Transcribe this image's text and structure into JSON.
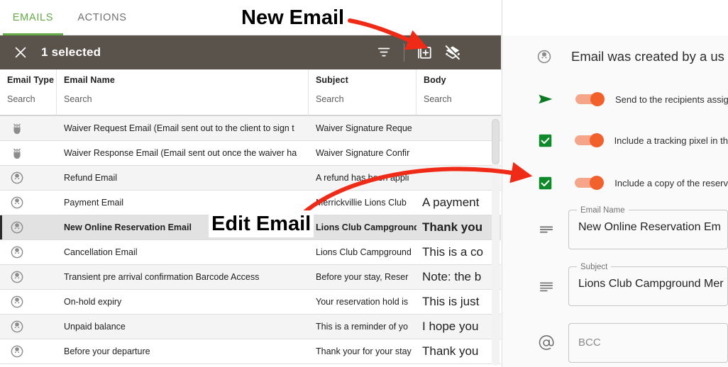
{
  "tabs": [
    {
      "label": "EMAILS",
      "active": true
    },
    {
      "label": "ACTIONS",
      "active": false
    }
  ],
  "selection_bar": {
    "close_icon": "close-icon",
    "count_label": "1 selected",
    "actions": [
      {
        "icon": "filter-icon",
        "name": "filter-button"
      },
      {
        "icon": "add-new-icon",
        "name": "new-email-button"
      },
      {
        "icon": "layers-off-icon",
        "name": "layers-off-button"
      }
    ]
  },
  "table": {
    "columns": [
      {
        "title": "Email Type",
        "search_placeholder": "Search"
      },
      {
        "title": "Email Name",
        "search_placeholder": "Search"
      },
      {
        "title": "Subject",
        "search_placeholder": "Search"
      },
      {
        "title": "Body",
        "search_placeholder": "Search"
      }
    ],
    "rows": [
      {
        "type_icon": "bug-icon",
        "name": "Waiver Request Email (Email sent out to the client to sign t",
        "subject": "Waiver Signature Reque",
        "body": "",
        "selected": false
      },
      {
        "type_icon": "bug-icon",
        "name": "Waiver Response Email (Email sent out once the waiver ha",
        "subject": "Waiver Signature Confir",
        "body": "",
        "selected": false
      },
      {
        "type_icon": "user-face-icon",
        "name": "Refund Email",
        "subject": "A refund has been appli",
        "body": "",
        "selected": false
      },
      {
        "type_icon": "user-face-icon",
        "name": "Payment Email",
        "subject": "Merrickvillie Lions Club",
        "body": "A payment",
        "selected": false
      },
      {
        "type_icon": "user-face-icon",
        "name": "New Online Reservation Email",
        "subject": "Lions Club Campground",
        "body": "Thank you",
        "selected": true
      },
      {
        "type_icon": "user-face-icon",
        "name": "Cancellation Email",
        "subject": "Lions Club Campground",
        "body": "This is a co",
        "selected": false
      },
      {
        "type_icon": "user-face-icon",
        "name": "Transient pre arrival confirmation Barcode Access",
        "subject": "Before your stay, Reser",
        "body": "Note: the b",
        "selected": false
      },
      {
        "type_icon": "user-face-icon",
        "name": "On-hold expiry",
        "subject": "Your reservation hold is",
        "body": "This is just",
        "selected": false
      },
      {
        "type_icon": "user-face-icon",
        "name": "Unpaid balance",
        "subject": "This is a reminder of yo",
        "body": "I hope you",
        "selected": false
      },
      {
        "type_icon": "user-face-icon",
        "name": "Before your departure",
        "subject": "Thank your for your stay",
        "body": "Thank you",
        "selected": false
      }
    ]
  },
  "detail_panel": {
    "header_icon": "user-face-icon",
    "header_title": "Email was created by a us",
    "toggles": [
      {
        "icon": "send-arrow-icon",
        "label": "Send to the recipients assig",
        "state": "on"
      },
      {
        "icon": "checkbox-checked-icon",
        "label": "Include a tracking pixel in th",
        "state": "on"
      },
      {
        "icon": "checkbox-checked-icon",
        "label": "Include a copy of the reserv",
        "state": "on"
      }
    ],
    "fields": [
      {
        "icon": "text-lines-icon",
        "legend": "Email Name",
        "value": "New Online Reservation Em",
        "placeholder": ""
      },
      {
        "icon": "text-lines-icon",
        "legend": "Subject",
        "value": "Lions Club Campground Mer",
        "placeholder": ""
      },
      {
        "icon": "at-sign-icon",
        "legend": "",
        "value": "",
        "placeholder": "BCC"
      }
    ]
  },
  "annotations": [
    {
      "text": "New Email",
      "name": "annotation-new-email"
    },
    {
      "text": "Edit Email",
      "name": "annotation-edit-email"
    }
  ],
  "colors": {
    "tab_active": "#62a844",
    "toolbar_bg": "#5a534c",
    "toggle_on": "#f2602c",
    "check_green": "#0f8a2a",
    "annotation_red": "#ef2b17"
  }
}
